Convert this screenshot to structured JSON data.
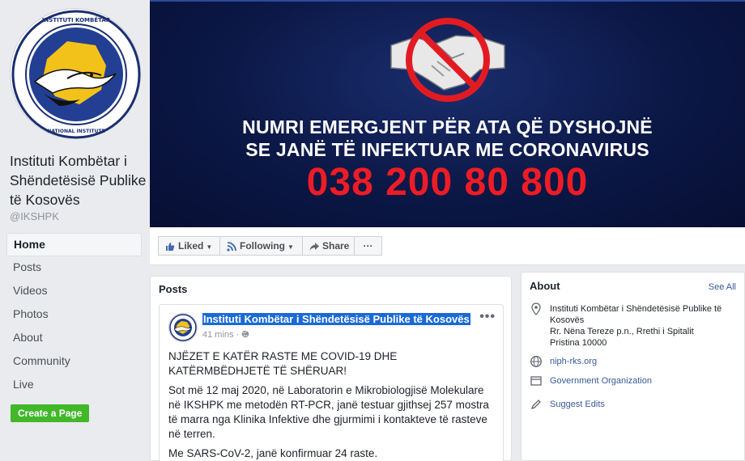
{
  "page": {
    "name": "Instituti Kombëtar i Shëndetësisë Publike të Kosovës",
    "handle": "@IKSHPK"
  },
  "logo": {
    "ring_text_top": "INSTITUTI KOMBËTAR I SHËNDETËSISË PUBLIKE TË KOSOVËS",
    "ring_text_bottom": "NATIONAL INSTITUTE OF PUBLIC HEALTH OF KOSOVA",
    "year": "MCMXXX"
  },
  "nav": {
    "items": [
      {
        "label": "Home",
        "active": true
      },
      {
        "label": "Posts"
      },
      {
        "label": "Videos"
      },
      {
        "label": "Photos"
      },
      {
        "label": "About"
      },
      {
        "label": "Community"
      },
      {
        "label": "Live"
      }
    ],
    "create_page": "Create a Page"
  },
  "cover": {
    "line1": "NUMRI EMERGJENT PËR ATA QË DYSHOJNË",
    "line2": "SE JANË TË INFEKTUAR ME CORONAVIRUS",
    "phone": "038 200 80 800",
    "icon": "no-handshake-icon"
  },
  "actions": {
    "liked": "Liked",
    "following": "Following",
    "share": "Share",
    "more": "···"
  },
  "posts": {
    "title": "Posts",
    "post": {
      "author": "Instituti Kombëtar i Shëndetësisë Publike të Kosovës",
      "time": "41 mins · ",
      "headline": "NJËZET E KATËR RASTE ME COVID-19 DHE KATËRMBËDHJETË TË SHËRUAR!",
      "para1": "Sot më 12 maj 2020, në Laboratorin e Mikrobiologjisë Molekulare në IKSHPK me metodën RT-PCR, janë testuar gjithsej 257 mostra të marra nga Klinika Infektive dhe gjurmimi i kontakteve të rasteve në terren.",
      "para2": "Me SARS-CoV-2, janë konfirmuar 24 raste."
    }
  },
  "about": {
    "title": "About",
    "see_all": "See All",
    "address": "Instituti Kombëtar i Shëndetësisë Publike të Kosovës\nRr. Nëna Tereze p.n., Rrethi i Spitalit\nPristina 10000",
    "website": "niph-rks.org",
    "category": "Government Organization",
    "suggest": "Suggest Edits"
  },
  "colors": {
    "fb_blue": "#385898",
    "cover_bg": "#0b1745",
    "phone_red": "#ee1c25",
    "create_green": "#42b72a"
  }
}
